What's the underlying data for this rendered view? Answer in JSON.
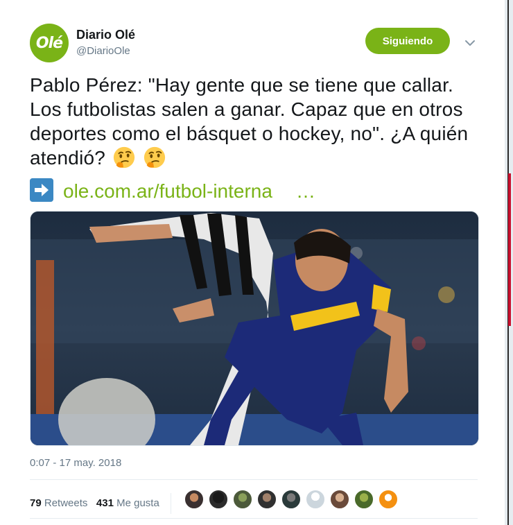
{
  "tweet": {
    "author": {
      "display_name": "Diario Olé",
      "handle": "@DiarioOle",
      "avatar_text": "Olé",
      "avatar_color": "#7ab317"
    },
    "follow_button_label": "Siguiendo",
    "text": "Pablo Pérez: \"Hay gente que se tiene que callar. Los futbolistas salen a ganar. Capaz que en otros deportes como el básquet o hockey, no\". ¿A quién atendió?",
    "emojis": [
      "thinking-face",
      "thinking-face"
    ],
    "link_text": "ole.com.ar/futbol-interna",
    "link_ellipsis": "…",
    "timestamp": "0:07 - 17 may. 2018",
    "retweets_count": "79",
    "retweets_label": "Retweets",
    "likes_count": "431",
    "likes_label": "Me gusta",
    "likers_count": 9
  },
  "colors": {
    "accent": "#7ab317",
    "link_arrow_bg": "#3b88c3",
    "text_primary": "#14171a",
    "text_secondary": "#657786"
  }
}
